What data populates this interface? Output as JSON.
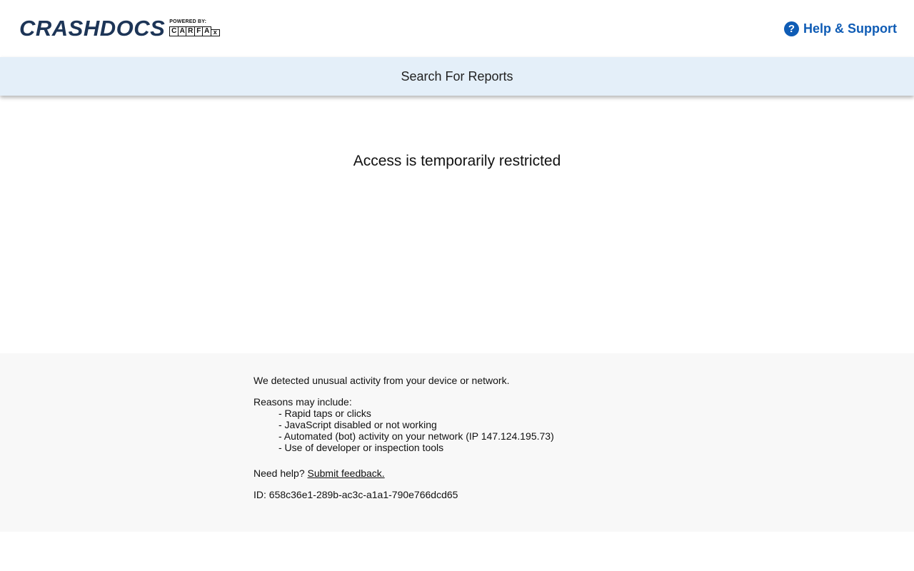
{
  "header": {
    "logo_text": "CRASHDOCS",
    "powered_by": "POWERED BY:",
    "carfax_letters": [
      "C",
      "A",
      "R",
      "F",
      "A"
    ],
    "carfax_x": "x",
    "help_icon": "question-circle-icon",
    "help_label": "Help & Support",
    "brand_color": "#1d3557",
    "accent_color": "#0f5cb5"
  },
  "subnav": {
    "search_label": "Search For Reports"
  },
  "main": {
    "title": "Access is temporarily restricted"
  },
  "footer": {
    "detected": "We detected unusual activity from your device or network.",
    "reasons_heading": "Reasons may include:",
    "reasons": [
      "- Rapid taps or clicks",
      "- JavaScript disabled or not working",
      "- Automated (bot) activity on your network (IP 147.124.195.73)",
      "- Use of developer or inspection tools"
    ],
    "need_help": "Need help? ",
    "feedback_link": "Submit feedback.",
    "id_line": "ID: 658c36e1-289b-ac3c-a1a1-790e766dcd65"
  }
}
